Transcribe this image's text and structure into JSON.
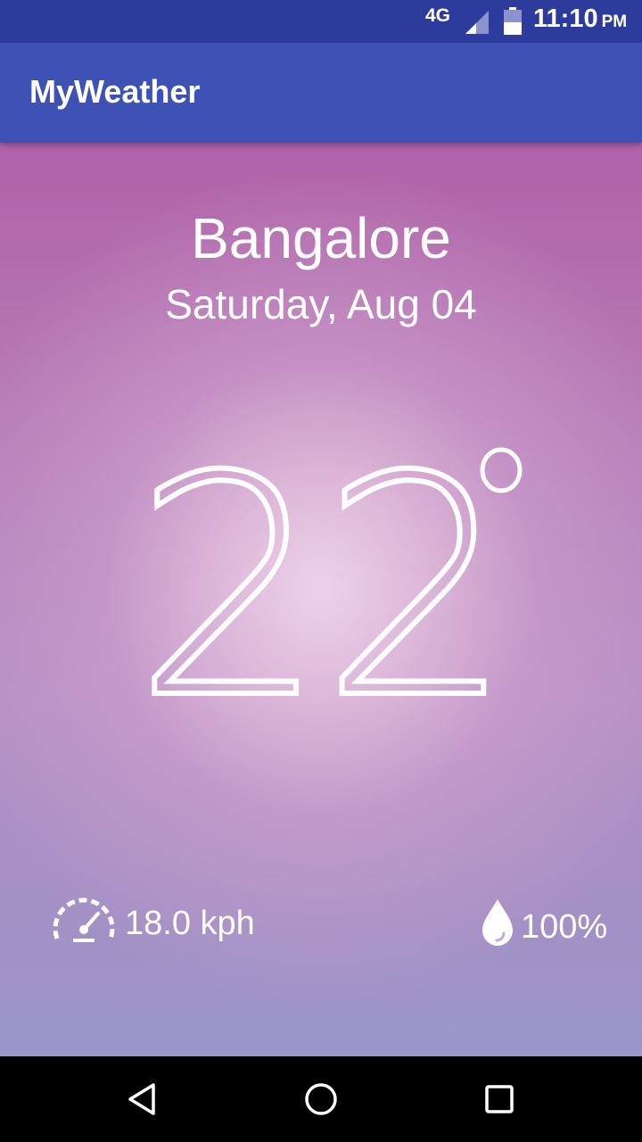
{
  "status_bar": {
    "network": "4G",
    "time": "11:10",
    "ampm": "PM",
    "icons": [
      "signal-icon",
      "battery-icon"
    ]
  },
  "app_bar": {
    "title": "MyWeather"
  },
  "weather": {
    "city": "Bangalore",
    "date": "Saturday, Aug 04",
    "temperature": "22",
    "degree_icon": "degree-circle-icon",
    "wind_speed": "18.0 kph",
    "wind_icon": "speedometer-icon",
    "humidity": "100%",
    "humidity_icon": "water-drop-icon"
  },
  "nav_bar": {
    "icons": [
      "back-icon",
      "home-icon",
      "recents-icon"
    ]
  },
  "colors": {
    "status_bar": "#2c3b9c",
    "app_bar": "#3e51b5",
    "gradient_top": "#b062a8",
    "gradient_center": "#ecd2e8",
    "gradient_bottom": "#9a97cb"
  }
}
